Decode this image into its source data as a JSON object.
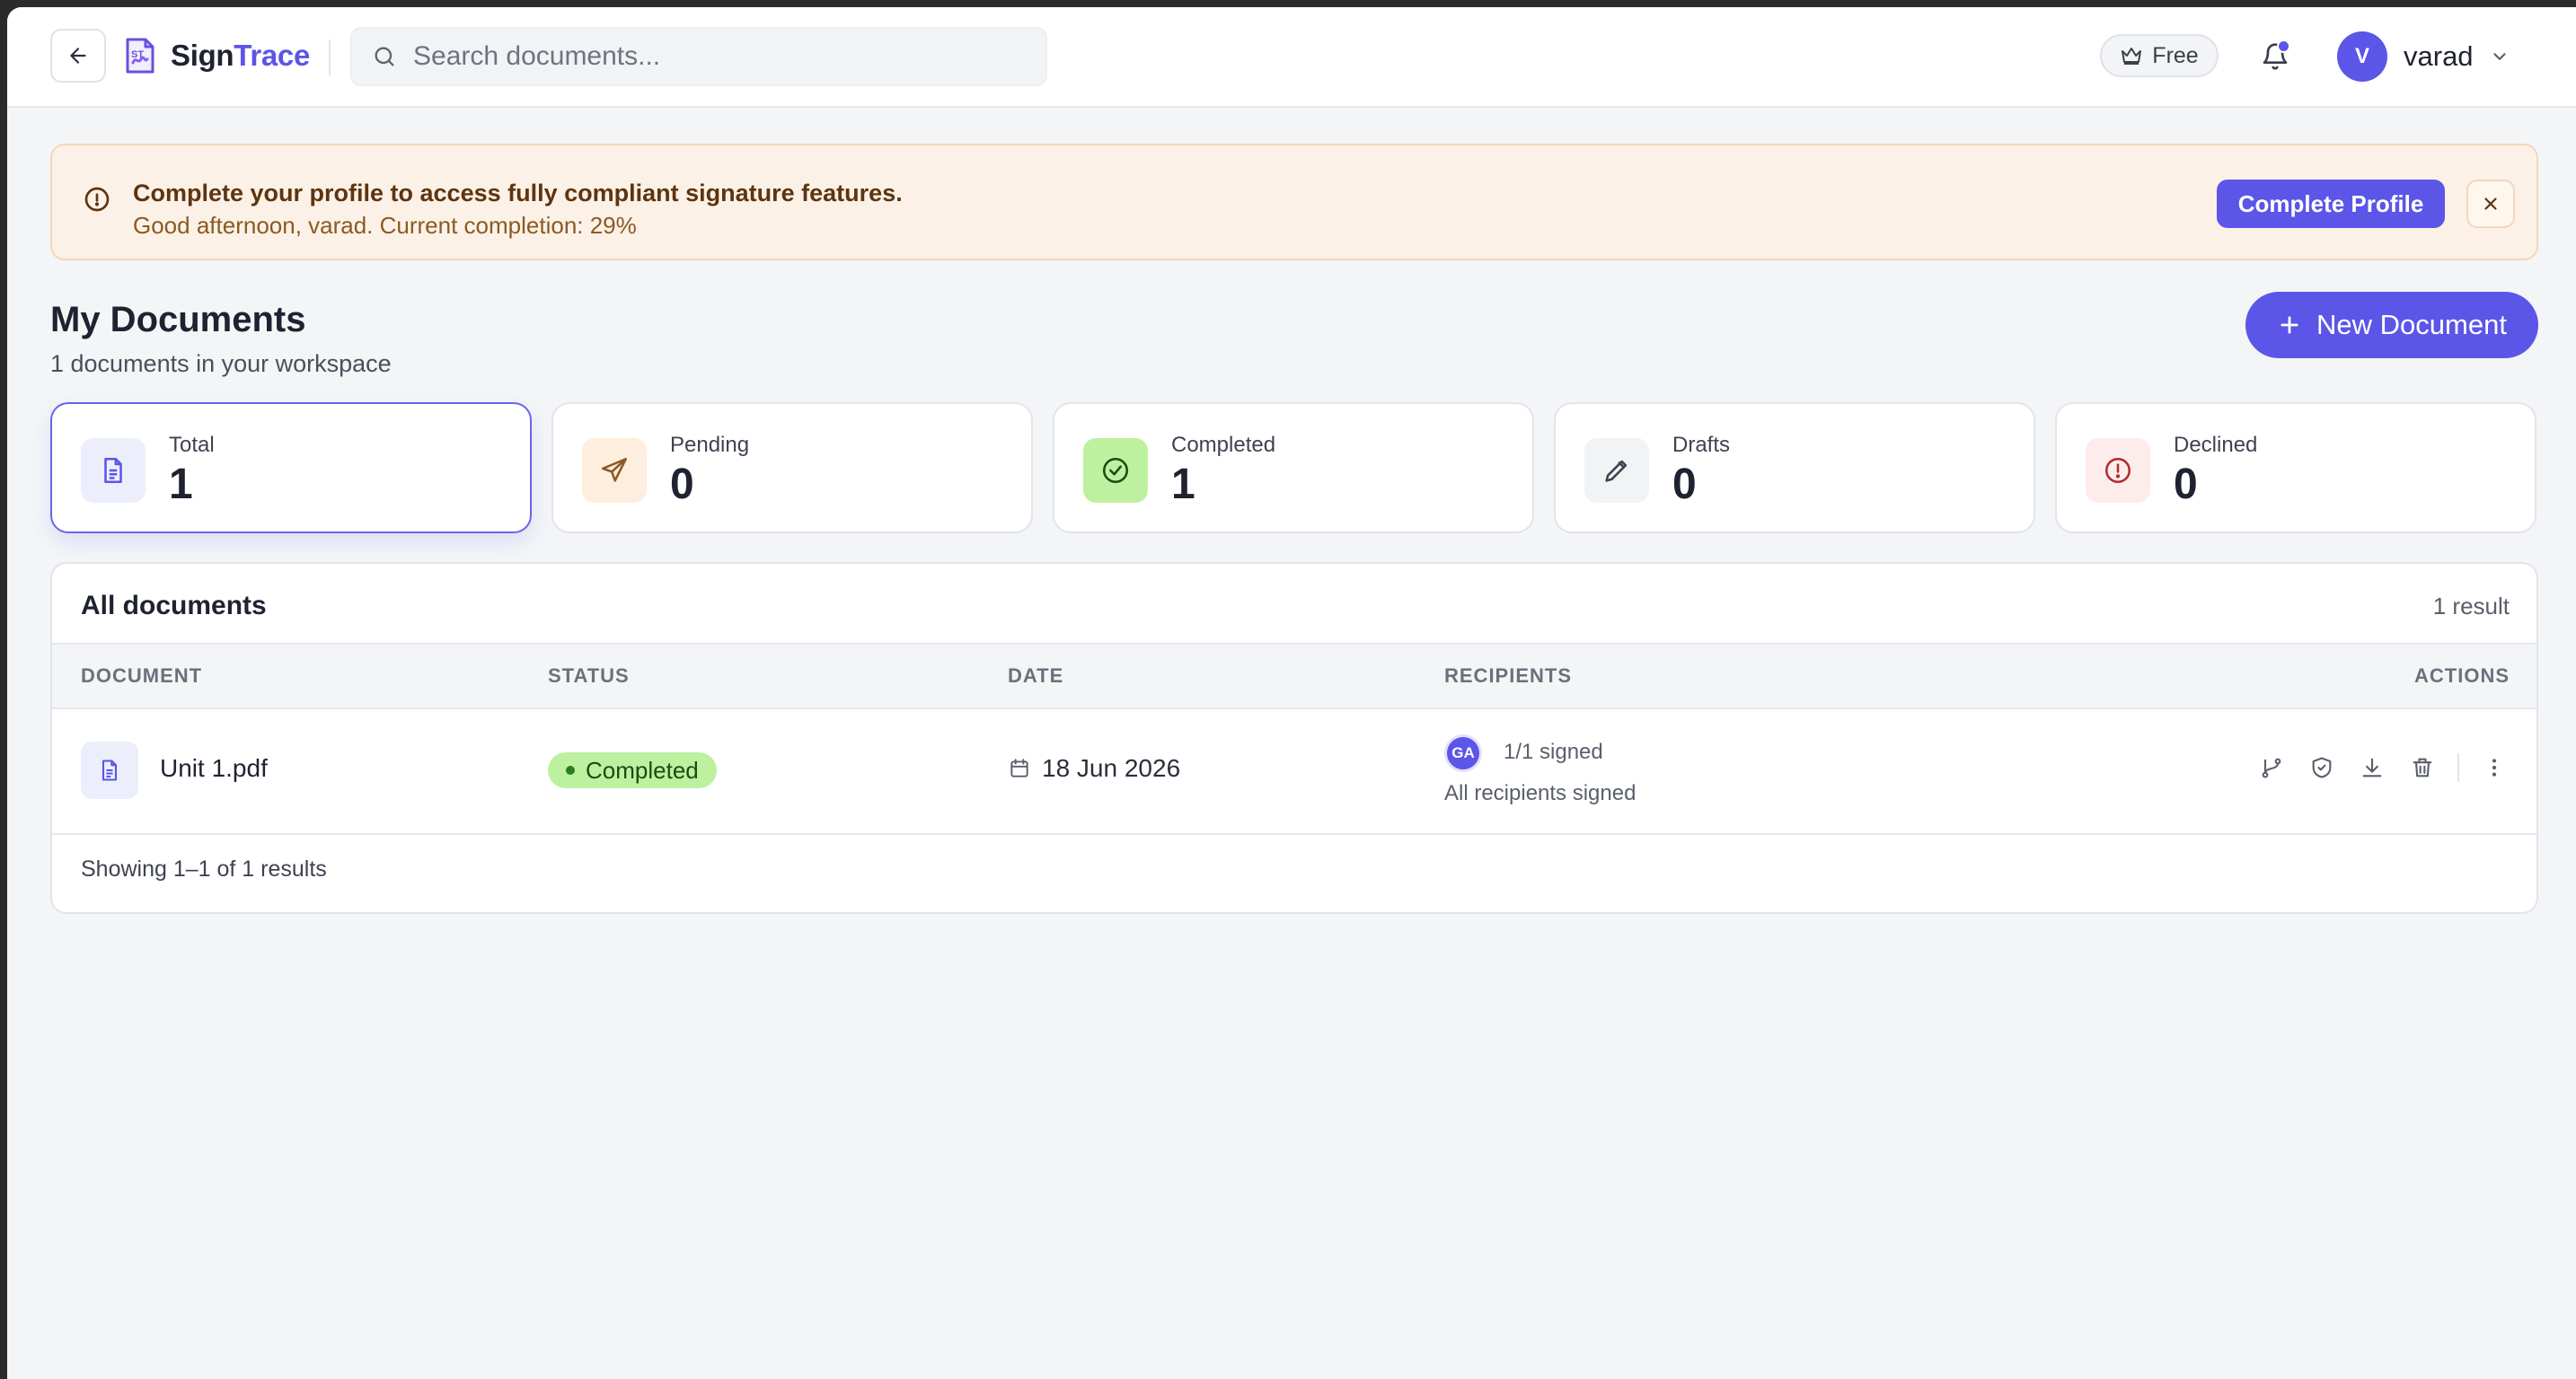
{
  "header": {
    "brand_prefix": "Sign",
    "brand_accent": "Trace",
    "search_placeholder": "Search documents...",
    "plan_label": "Free",
    "user": {
      "initial": "V",
      "name": "varad"
    }
  },
  "banner": {
    "title": "Complete your profile to access fully compliant signature features.",
    "subtitle": "Good afternoon, varad. Current completion: 29%",
    "button_label": "Complete Profile"
  },
  "page": {
    "title": "My Documents",
    "subtitle": "1 documents in your workspace",
    "new_button_label": "New Document"
  },
  "stats": [
    {
      "label": "Total",
      "value": "1",
      "icon": "document-icon"
    },
    {
      "label": "Pending",
      "value": "0",
      "icon": "send-icon"
    },
    {
      "label": "Completed",
      "value": "1",
      "icon": "check-circle-icon"
    },
    {
      "label": "Drafts",
      "value": "0",
      "icon": "pencil-icon"
    },
    {
      "label": "Declined",
      "value": "0",
      "icon": "alert-circle-icon"
    }
  ],
  "table": {
    "title": "All documents",
    "result_count": "1 result",
    "columns": [
      "DOCUMENT",
      "STATUS",
      "DATE",
      "RECIPIENTS",
      "ACTIONS"
    ],
    "rows": [
      {
        "name": "Unit 1.pdf",
        "status": "Completed",
        "date": "18 Jun 2026",
        "recipient_initials": "GA",
        "signed": "1/1 signed",
        "recipient_status": "All recipients signed"
      }
    ],
    "footer": "Showing 1–1 of 1 results"
  },
  "colors": {
    "accent": "#5b55e8",
    "banner_bg": "#fcf1e6",
    "completed_pill": "#bdf1a0"
  }
}
